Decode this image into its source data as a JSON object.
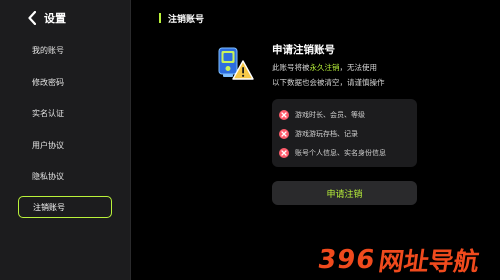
{
  "sidebar": {
    "title": "设置",
    "items": [
      {
        "label": "我的账号"
      },
      {
        "label": "修改密码"
      },
      {
        "label": "实名认证"
      },
      {
        "label": "用户协议"
      },
      {
        "label": "隐私协议"
      },
      {
        "label": "注销账号",
        "active": true
      }
    ]
  },
  "header": {
    "title": "注销账号"
  },
  "card": {
    "title": "申请注销账号",
    "desc_part1": "此账号将被",
    "desc_highlight": "永久注销",
    "desc_part2": "，无法使用",
    "desc_line2": "以下数据也会被清空，请谨慎操作",
    "warnings": [
      "游戏时长、会员、等级",
      "游戏游玩存档、记录",
      "账号个人信息、实名身份信息"
    ],
    "button_label": "申请注销"
  },
  "watermark": {
    "number": "396",
    "text": "网址导航"
  },
  "colors": {
    "accent": "#b9f23a",
    "danger": "#ff5c6c",
    "watermark": "#f04a1d"
  }
}
